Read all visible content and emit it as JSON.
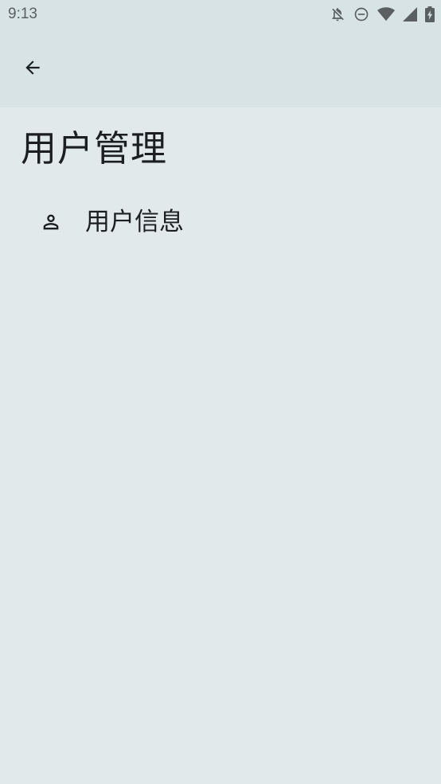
{
  "status_bar": {
    "time": "9:13",
    "icons": [
      "notifications-off-icon",
      "do-not-disturb-icon",
      "wifi-icon",
      "cellular-signal-icon",
      "battery-charging-icon"
    ]
  },
  "app_bar": {
    "back_icon": "arrow-back-icon"
  },
  "page": {
    "title": "用户管理"
  },
  "menu": {
    "items": [
      {
        "icon": "person-icon",
        "label": "用户信息"
      }
    ]
  },
  "colors": {
    "background": "#e1e9eb",
    "app_bar": "#d7e3e4",
    "text": "#1b1f21",
    "status_text": "#5a6062"
  }
}
